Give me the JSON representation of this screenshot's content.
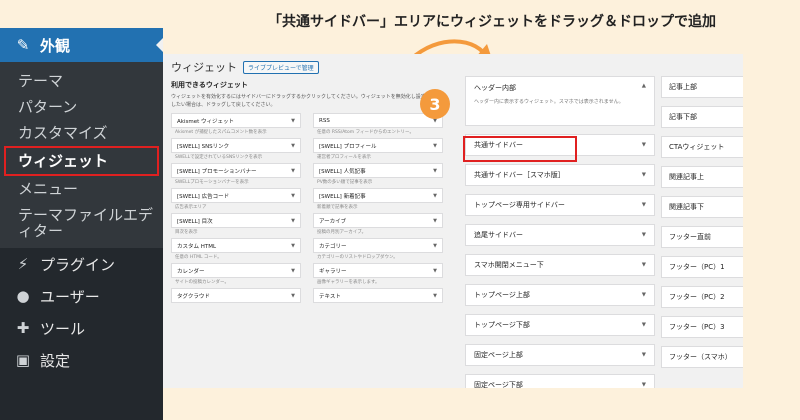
{
  "headline": "「共通サイドバー」エリアにウィジェットをドラッグ＆ドロップで追加",
  "step_number": "3",
  "colors": {
    "accent": "#2271b1",
    "sidebar": "#23282d",
    "highlight": "#e02020",
    "arrow": "#f49a3c",
    "background": "#fdf1dc"
  },
  "sidebar": {
    "top_label": "外観",
    "top_icon": "paintbrush-icon",
    "sub_items": [
      "テーマ",
      "パターン",
      "カスタマイズ",
      "ウィジェット",
      "メニュー",
      "テーマファイルエディター"
    ],
    "current_sub": "ウィジェット",
    "main_items": [
      {
        "label": "プラグイン",
        "icon": "plugin-icon"
      },
      {
        "label": "ユーザー",
        "icon": "user-icon"
      },
      {
        "label": "ツール",
        "icon": "wrench-icon"
      },
      {
        "label": "設定",
        "icon": "settings-icon"
      }
    ]
  },
  "page": {
    "title": "ウィジェット",
    "live_preview_button": "ライブプレビューで管理"
  },
  "available": {
    "heading": "利用できるウィジェット",
    "description": "ウィジェットを有効化するにはサイドバーにドラッグするかクリックしてください。ウィジェットを無効化し設定を削除したい場合は、ドラッグして戻してください。",
    "widgets": [
      {
        "name": "Akismet ウィジェット",
        "desc": "Akismet が捕捉したスパムコメント数を表示"
      },
      {
        "name": "RSS",
        "desc": "任意の RSS/Atom フィードからのエントリー。"
      },
      {
        "name": "[SWELL] SNSリンク",
        "desc": "SWELLで設定されているSNSリンクを表示"
      },
      {
        "name": "[SWELL] プロフィール",
        "desc": "運営者プロフィールを表示"
      },
      {
        "name": "[SWELL] プロモーションバナー",
        "desc": "SWELLプロモーションバナーを表示"
      },
      {
        "name": "[SWELL] 人気記事",
        "desc": "PV数の多い順で記事を表示"
      },
      {
        "name": "[SWELL] 広告コード",
        "desc": "広告表示エリア"
      },
      {
        "name": "[SWELL] 新着記事",
        "desc": "新着順で記事を表示"
      },
      {
        "name": "[SWELL] 目次",
        "desc": "目次を表示"
      },
      {
        "name": "アーカイブ",
        "desc": "投稿の月別アーカイブ。"
      },
      {
        "name": "カスタム HTML",
        "desc": "任意の HTML コード。"
      },
      {
        "name": "カテゴリー",
        "desc": "カテゴリーのリストやドロップダウン。"
      },
      {
        "name": "カレンダー",
        "desc": "サイトの投稿カレンダー。"
      },
      {
        "name": "ギャラリー",
        "desc": "画像ギャラリーを表示します。"
      },
      {
        "name": "タグクラウド",
        "desc": ""
      },
      {
        "name": "テキスト",
        "desc": ""
      }
    ]
  },
  "areas_col1": {
    "header": {
      "name": "ヘッダー内部",
      "desc": "ヘッダー内に表示するウィジェット。スマホでは表示されません。"
    },
    "items": [
      "共通サイドバー",
      "共通サイドバー［スマホ版］",
      "トップページ専用サイドバー",
      "追尾サイドバー",
      "スマホ開閉メニュー下",
      "トップページ上部",
      "トップページ下部",
      "固定ページ上部",
      "固定ページ下部"
    ]
  },
  "areas_col2": [
    "記事上部",
    "記事下部",
    "CTAウィジェット",
    "関連記事上",
    "関連記事下",
    "フッター直前",
    "フッター（PC）1",
    "フッター（PC）2",
    "フッター（PC）3",
    "フッター（スマホ）"
  ]
}
